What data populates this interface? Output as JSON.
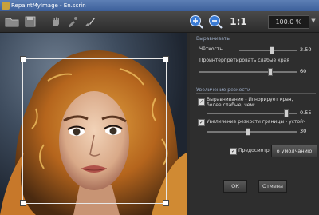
{
  "window": {
    "title": "RepaintMyImage - En.scrin"
  },
  "toolbar": {
    "zoom_ratio": "1:1",
    "zoom_value": "100.0 %",
    "icons": [
      "open-folder-icon",
      "save-icon",
      "hand-icon",
      "eyedropper-icon",
      "brush-icon",
      "zoom-in-icon",
      "zoom-out-icon"
    ]
  },
  "panel": {
    "smoothing": {
      "title": "Выравнивать",
      "clarity_label": "Чёткость",
      "clarity_value": "2.50",
      "clarity_level": 0.55,
      "weak_edges_label": "Проинтерпретировать слабые края",
      "weak_edges_value": "60",
      "weak_edges_level": 0.72
    },
    "sharpen": {
      "title": "Увеличение резкости",
      "ignore_weak_label": "Выравнивание - Игнорирует края, более слабые, чем:",
      "ignore_weak_value": "0.55",
      "ignore_weak_level": 0.88,
      "boost_edges_label": "Увеличение резкости границы - устойч",
      "boost_edges_value": "30",
      "boost_edges_level": 0.45
    },
    "preview_label": "Предосмотр",
    "default_button": "о умолчанию",
    "ok_button": "ОК",
    "cancel_button": "Отмена"
  },
  "colors": {
    "panel_bg": "#2e2e2e",
    "titlebar": "#4a6ea8",
    "accent_icon": "#3a7bd5"
  }
}
